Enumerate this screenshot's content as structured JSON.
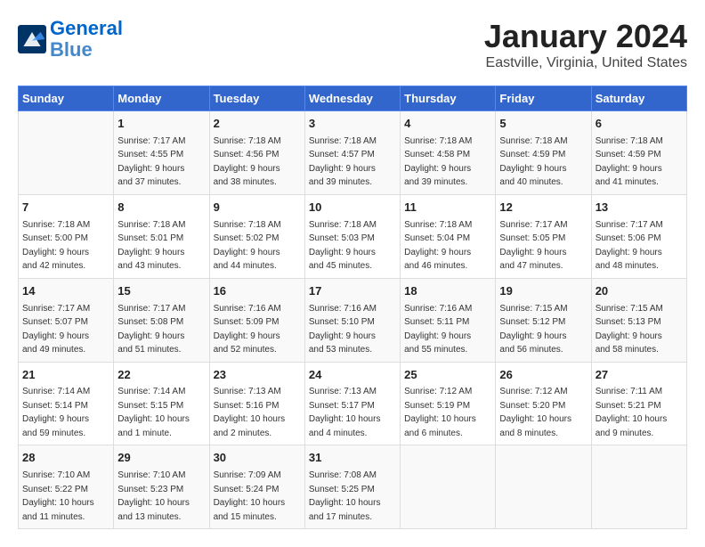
{
  "header": {
    "logo_line1": "General",
    "logo_line2": "Blue",
    "title": "January 2024",
    "subtitle": "Eastville, Virginia, United States"
  },
  "columns": [
    "Sunday",
    "Monday",
    "Tuesday",
    "Wednesday",
    "Thursday",
    "Friday",
    "Saturday"
  ],
  "weeks": [
    [
      {
        "day": "",
        "info": ""
      },
      {
        "day": "1",
        "info": "Sunrise: 7:17 AM\nSunset: 4:55 PM\nDaylight: 9 hours\nand 37 minutes."
      },
      {
        "day": "2",
        "info": "Sunrise: 7:18 AM\nSunset: 4:56 PM\nDaylight: 9 hours\nand 38 minutes."
      },
      {
        "day": "3",
        "info": "Sunrise: 7:18 AM\nSunset: 4:57 PM\nDaylight: 9 hours\nand 39 minutes."
      },
      {
        "day": "4",
        "info": "Sunrise: 7:18 AM\nSunset: 4:58 PM\nDaylight: 9 hours\nand 39 minutes."
      },
      {
        "day": "5",
        "info": "Sunrise: 7:18 AM\nSunset: 4:59 PM\nDaylight: 9 hours\nand 40 minutes."
      },
      {
        "day": "6",
        "info": "Sunrise: 7:18 AM\nSunset: 4:59 PM\nDaylight: 9 hours\nand 41 minutes."
      }
    ],
    [
      {
        "day": "7",
        "info": "Sunrise: 7:18 AM\nSunset: 5:00 PM\nDaylight: 9 hours\nand 42 minutes."
      },
      {
        "day": "8",
        "info": "Sunrise: 7:18 AM\nSunset: 5:01 PM\nDaylight: 9 hours\nand 43 minutes."
      },
      {
        "day": "9",
        "info": "Sunrise: 7:18 AM\nSunset: 5:02 PM\nDaylight: 9 hours\nand 44 minutes."
      },
      {
        "day": "10",
        "info": "Sunrise: 7:18 AM\nSunset: 5:03 PM\nDaylight: 9 hours\nand 45 minutes."
      },
      {
        "day": "11",
        "info": "Sunrise: 7:18 AM\nSunset: 5:04 PM\nDaylight: 9 hours\nand 46 minutes."
      },
      {
        "day": "12",
        "info": "Sunrise: 7:17 AM\nSunset: 5:05 PM\nDaylight: 9 hours\nand 47 minutes."
      },
      {
        "day": "13",
        "info": "Sunrise: 7:17 AM\nSunset: 5:06 PM\nDaylight: 9 hours\nand 48 minutes."
      }
    ],
    [
      {
        "day": "14",
        "info": "Sunrise: 7:17 AM\nSunset: 5:07 PM\nDaylight: 9 hours\nand 49 minutes."
      },
      {
        "day": "15",
        "info": "Sunrise: 7:17 AM\nSunset: 5:08 PM\nDaylight: 9 hours\nand 51 minutes."
      },
      {
        "day": "16",
        "info": "Sunrise: 7:16 AM\nSunset: 5:09 PM\nDaylight: 9 hours\nand 52 minutes."
      },
      {
        "day": "17",
        "info": "Sunrise: 7:16 AM\nSunset: 5:10 PM\nDaylight: 9 hours\nand 53 minutes."
      },
      {
        "day": "18",
        "info": "Sunrise: 7:16 AM\nSunset: 5:11 PM\nDaylight: 9 hours\nand 55 minutes."
      },
      {
        "day": "19",
        "info": "Sunrise: 7:15 AM\nSunset: 5:12 PM\nDaylight: 9 hours\nand 56 minutes."
      },
      {
        "day": "20",
        "info": "Sunrise: 7:15 AM\nSunset: 5:13 PM\nDaylight: 9 hours\nand 58 minutes."
      }
    ],
    [
      {
        "day": "21",
        "info": "Sunrise: 7:14 AM\nSunset: 5:14 PM\nDaylight: 9 hours\nand 59 minutes."
      },
      {
        "day": "22",
        "info": "Sunrise: 7:14 AM\nSunset: 5:15 PM\nDaylight: 10 hours\nand 1 minute."
      },
      {
        "day": "23",
        "info": "Sunrise: 7:13 AM\nSunset: 5:16 PM\nDaylight: 10 hours\nand 2 minutes."
      },
      {
        "day": "24",
        "info": "Sunrise: 7:13 AM\nSunset: 5:17 PM\nDaylight: 10 hours\nand 4 minutes."
      },
      {
        "day": "25",
        "info": "Sunrise: 7:12 AM\nSunset: 5:19 PM\nDaylight: 10 hours\nand 6 minutes."
      },
      {
        "day": "26",
        "info": "Sunrise: 7:12 AM\nSunset: 5:20 PM\nDaylight: 10 hours\nand 8 minutes."
      },
      {
        "day": "27",
        "info": "Sunrise: 7:11 AM\nSunset: 5:21 PM\nDaylight: 10 hours\nand 9 minutes."
      }
    ],
    [
      {
        "day": "28",
        "info": "Sunrise: 7:10 AM\nSunset: 5:22 PM\nDaylight: 10 hours\nand 11 minutes."
      },
      {
        "day": "29",
        "info": "Sunrise: 7:10 AM\nSunset: 5:23 PM\nDaylight: 10 hours\nand 13 minutes."
      },
      {
        "day": "30",
        "info": "Sunrise: 7:09 AM\nSunset: 5:24 PM\nDaylight: 10 hours\nand 15 minutes."
      },
      {
        "day": "31",
        "info": "Sunrise: 7:08 AM\nSunset: 5:25 PM\nDaylight: 10 hours\nand 17 minutes."
      },
      {
        "day": "",
        "info": ""
      },
      {
        "day": "",
        "info": ""
      },
      {
        "day": "",
        "info": ""
      }
    ]
  ]
}
